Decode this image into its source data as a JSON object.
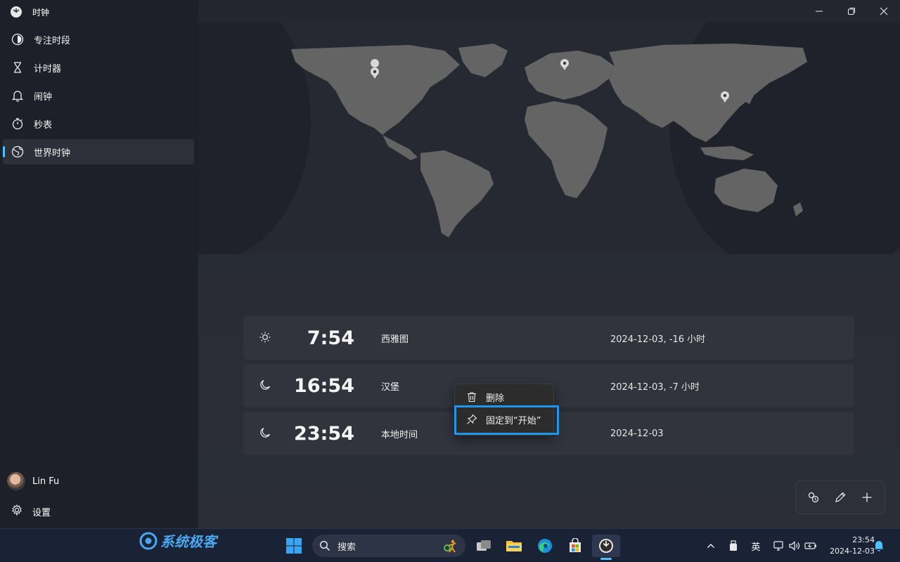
{
  "app": {
    "title": "时钟"
  },
  "sidebar": {
    "items": [
      {
        "label": "专注时段",
        "icon": "focus-icon"
      },
      {
        "label": "计时器",
        "icon": "hourglass-icon"
      },
      {
        "label": "闹钟",
        "icon": "bell-icon"
      },
      {
        "label": "秒表",
        "icon": "stopwatch-icon"
      },
      {
        "label": "世界时钟",
        "icon": "globe-icon",
        "active": true
      }
    ],
    "user_name": "Lin Fu",
    "settings_label": "设置"
  },
  "world_clocks": [
    {
      "icon": "sun-icon",
      "time": "7:54",
      "city": "西雅图",
      "date": "2024-12-03, -16 小时"
    },
    {
      "icon": "moon-icon",
      "time": "16:54",
      "city": "汉堡",
      "date": "2024-12-03, -7 小时"
    },
    {
      "icon": "moon-icon",
      "time": "23:54",
      "city": "本地时间",
      "date": "2024-12-03"
    }
  ],
  "context_menu": {
    "delete_label": "删除",
    "pin_label": "固定到“开始”"
  },
  "taskbar": {
    "watermark": "系统极客",
    "search_placeholder": "搜索",
    "ime_label": "英",
    "time": "23:54",
    "date": "2024-12-03"
  },
  "colors": {
    "accent": "#4cc2ff",
    "highlight_box": "#2196e8",
    "card_bg": "#31343d",
    "sidebar_bg": "#1d2028"
  }
}
